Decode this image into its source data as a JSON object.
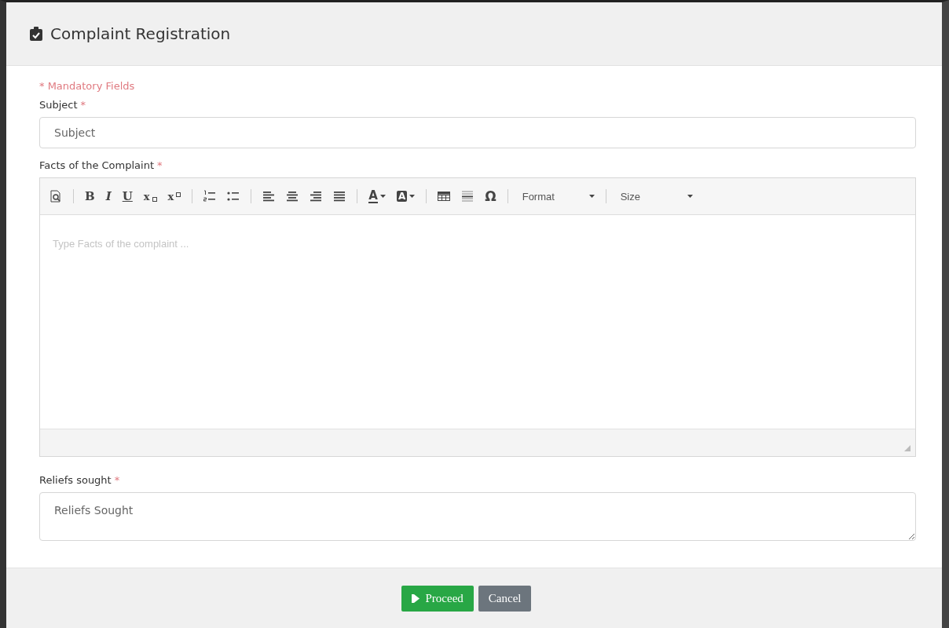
{
  "dialog": {
    "title": "Complaint Registration"
  },
  "note": "* Mandatory Fields",
  "subject": {
    "label": "Subject",
    "mark": "*",
    "placeholder": "Subject"
  },
  "facts": {
    "label": "Facts of the Complaint",
    "mark": "*",
    "placeholder": "Type Facts of the complaint ...",
    "toolbar": [
      [
        {
          "kind": "preview"
        }
      ],
      [
        {
          "kind": "bold",
          "glyph": "B"
        },
        {
          "kind": "italic",
          "glyph": "I"
        },
        {
          "kind": "underline",
          "glyph": "U"
        },
        {
          "kind": "subscript",
          "glyph": "x"
        },
        {
          "kind": "superscript",
          "glyph": "x"
        }
      ],
      [
        {
          "kind": "ol"
        },
        {
          "kind": "ul"
        }
      ],
      [
        {
          "kind": "left"
        },
        {
          "kind": "center"
        },
        {
          "kind": "right"
        },
        {
          "kind": "justify"
        }
      ],
      [
        {
          "kind": "textcolor",
          "glyph": "A"
        },
        {
          "kind": "bgcolor",
          "glyph": "A"
        }
      ],
      [
        {
          "kind": "table"
        },
        {
          "kind": "hr"
        },
        {
          "kind": "special",
          "glyph": "Ω"
        }
      ],
      [
        {
          "kind": "dropdown",
          "label": "Format"
        }
      ],
      [
        {
          "kind": "dropdown",
          "label": "Size"
        }
      ]
    ]
  },
  "reliefs": {
    "label": "Reliefs sought",
    "mark": "*",
    "placeholder": "Reliefs Sought"
  },
  "buttons": [
    {
      "kind": "primary",
      "label": "Proceed"
    },
    {
      "kind": "secondary",
      "label": "Cancel"
    }
  ]
}
